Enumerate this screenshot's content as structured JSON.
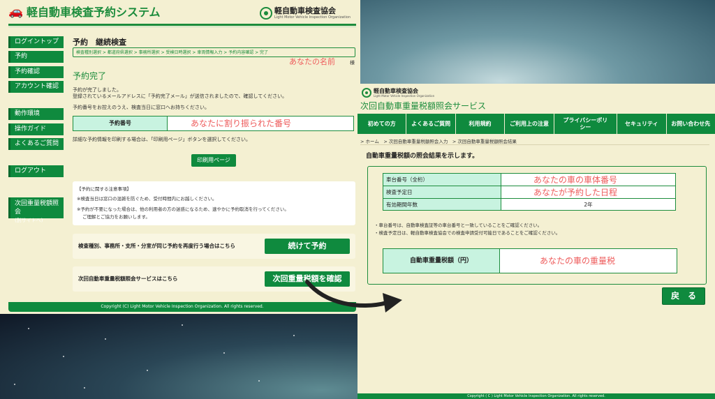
{
  "left": {
    "app_title": "軽自動車検査予約システム",
    "logo_name": "軽自動車検査協会",
    "logo_sub": "Light Motor Vehicle Inspection Organization",
    "sidebar": [
      {
        "label": "ログイントップ"
      },
      {
        "label": "予約"
      },
      {
        "label": "予約確認"
      },
      {
        "label": "アカウント確認"
      },
      {
        "label": "動作環境"
      },
      {
        "label": "操作ガイド"
      },
      {
        "label": "よくあるご質問"
      },
      {
        "label": "ログアウト"
      },
      {
        "label": "次回重量税額照会",
        "sub": "(別サイトへ)"
      }
    ],
    "page_title": "予約　継続検査",
    "breadcrumb": "検査種別選択 > 都道府県選択 > 事務所選択 > 受検日時選択 > 車両情報入力 > 予約内容確認 > 完了",
    "name_annotation": "あなたの名前",
    "name_suffix": "様",
    "heading": "予約完了",
    "para1": "予約が完了しました。",
    "para2": "登録されているメールアドレスに「予約完了メール」が送信されましたので、確認してください。",
    "para3": "予約番号をお控えのうえ、検査当日に窓口へお持ちください。",
    "number_label": "予約番号",
    "number_annotation": "あなたに割り振られた番号",
    "print_note": "詳細な予約情報を印刷する場合は、「印刷用ページ」ボタンを選択してください。",
    "print_button": "印刷用ページ",
    "notice_title": "【予約に関する注意事項】",
    "notice1": "※検査当日は窓口の混雑を防ぐため、受付時間内にお越しください。",
    "notice2": "※予約が不要になった場合は、他の利用者の方の迷惑になるため、速やかに予約取消を行ってください。",
    "notice3": "ご理解とご協力をお願いします。",
    "continue_text": "検査種別、事務所・支所・分室が同じ予約を再度行う場合はこちら",
    "continue_button": "続けて予約",
    "tax_text": "次回自動車重量税額照会サービスはこちら",
    "tax_button": "次回重量税額を確認",
    "footer": "Copyright (C) Light Motor Vehicle Inspection Organization. All rights reserved."
  },
  "right": {
    "logo_name": "軽自動車検査協会",
    "logo_sub": "Light Motor Vehicle Inspection Organization",
    "site_title": "次回自動車重量税額照会サービス",
    "nav": [
      "初めての方",
      "よくあるご質問",
      "利用規約",
      "ご利用上の注意",
      "プライバシーポリシー",
      "セキュリティ",
      "お問い合わせ先"
    ],
    "breadcrumb": "> ホーム　> 次回自動車重量税額照会入力　> 次回自動車重量税額照会結果",
    "heading": "自動車重量税額の照会結果を示します。",
    "rows": [
      {
        "label": "車台番号（全桁）",
        "value": "あなたの車の車体番号"
      },
      {
        "label": "検査予定日",
        "value": "あなたが予約した日程"
      },
      {
        "label": "有効期間年数",
        "value": "2年"
      }
    ],
    "note1": "・車台番号は、自動車検査証等の車台番号と一致していることをご確認ください。",
    "note2": "・検査予定日は、軽自動車検査協会での検査申請受付可能日であることをご確認ください。",
    "tax_label": "自動車重量税額（円）",
    "tax_value": "あなたの車の重量税",
    "back_button": "戻　る",
    "footer": "Copyright ( C ) Light Motor Vehicle Inspection Organization. All rights reserved."
  },
  "colors": {
    "brand_green": "#0f8a3e",
    "annotation_red": "#ee5b5b",
    "panel_bg": "#f4f0d2",
    "highlight": "#c8f3e0"
  }
}
